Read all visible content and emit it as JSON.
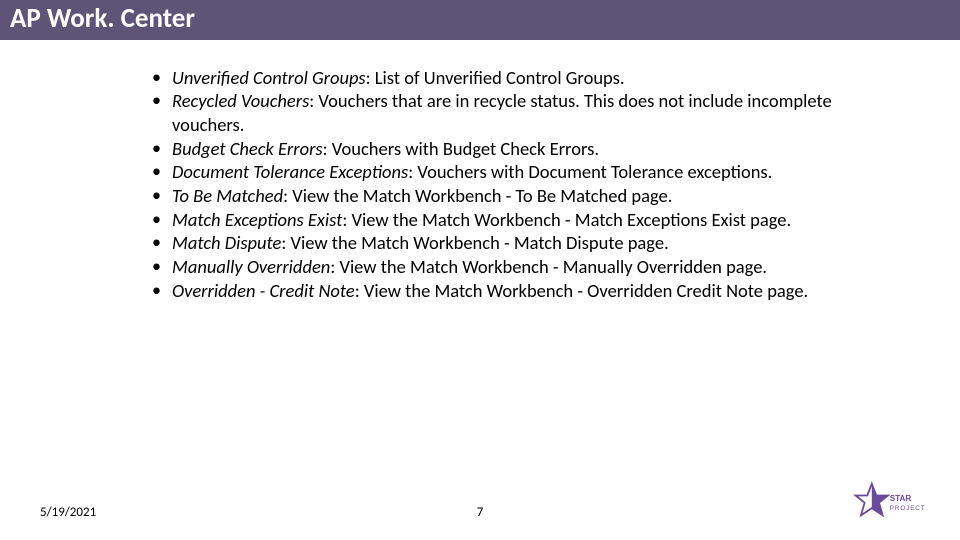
{
  "header": {
    "title": "AP Work. Center"
  },
  "bullets": [
    {
      "term": "Unverified Control Groups",
      "desc": ": List of Unverified Control Groups."
    },
    {
      "term": "Recycled Vouchers",
      "desc": ": Vouchers that are in recycle status. This does not include incomplete vouchers."
    },
    {
      "term": "Budget Check Errors",
      "desc": ": Vouchers with Budget Check Errors."
    },
    {
      "term": "Document Tolerance Exceptions",
      "desc": ": Vouchers with Document Tolerance exceptions."
    },
    {
      "term": "To Be Matched",
      "desc": ": View the Match Workbench - To Be Matched page."
    },
    {
      "term": "Match Exceptions Exist",
      "desc": ": View the Match Workbench - Match Exceptions Exist page."
    },
    {
      "term": "Match Dispute",
      "desc": ": View the Match Workbench - Match Dispute page."
    },
    {
      "term": "Manually Overridden",
      "desc": ": View the Match Workbench - Manually Overridden page."
    },
    {
      "term": "Overridden - Credit Note",
      "desc": ": View the Match Workbench - Overridden Credit Note page."
    }
  ],
  "footer": {
    "date": "5/19/2021",
    "page": "7",
    "logo_text": "STAR PROJECT"
  },
  "colors": {
    "header_bg": "#5d5478",
    "accent": "#6c4a9b"
  }
}
